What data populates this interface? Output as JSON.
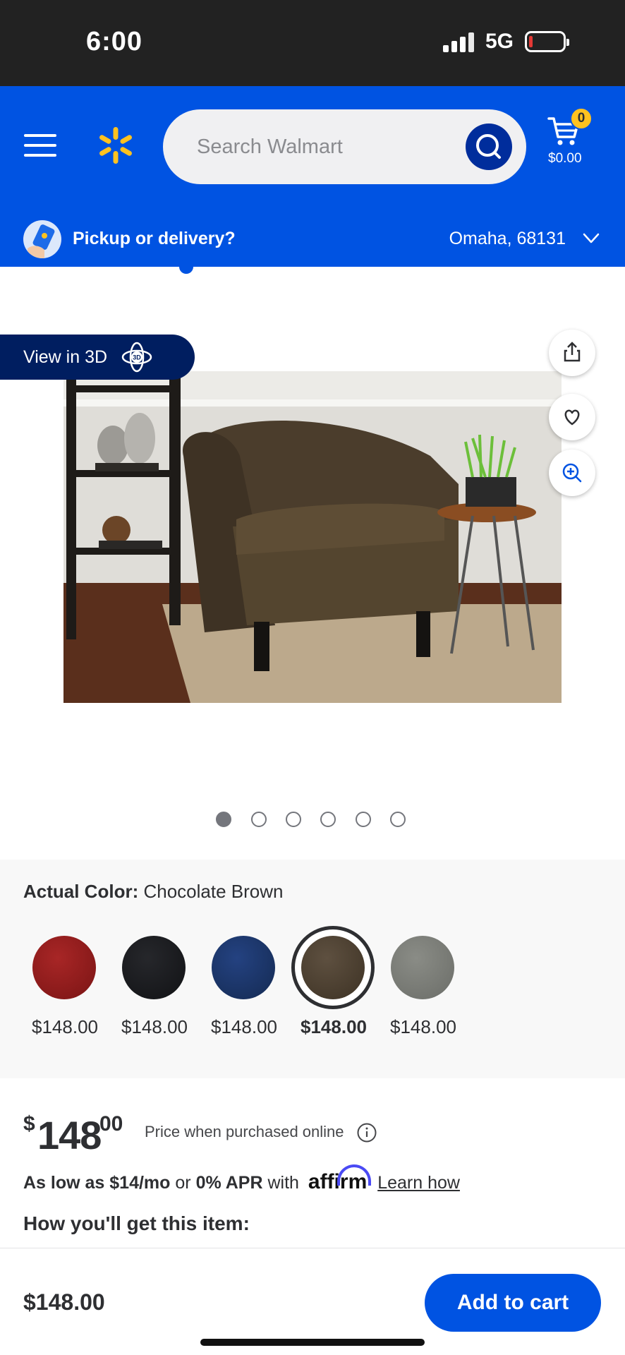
{
  "status_bar": {
    "time": "6:00",
    "network": "5G"
  },
  "header": {
    "search": {
      "placeholder": "Search Walmart"
    },
    "cart": {
      "count": "0",
      "total": "$0.00"
    },
    "pickup": {
      "label": "Pickup or delivery?",
      "location": "Omaha, 68131"
    }
  },
  "gallery": {
    "view3d_label": "View in 3D",
    "dots_total": 6,
    "active_dot": 1
  },
  "variants": {
    "label": "Actual Color:",
    "selected_color": "Chocolate Brown",
    "swatches": [
      {
        "color": "#8f1c1c",
        "price": "$148.00",
        "selected": false
      },
      {
        "color": "#18191c",
        "price": "$148.00",
        "selected": false
      },
      {
        "color": "#1d3564",
        "price": "$148.00",
        "selected": false
      },
      {
        "color": "#4e4232",
        "price": "$148.00",
        "selected": true
      },
      {
        "color": "#7b7d77",
        "price": "$148.00",
        "selected": false
      }
    ]
  },
  "price": {
    "currency": "$",
    "dollars": "148",
    "cents": "00",
    "note": "Price when purchased online",
    "affirm": {
      "as_low_as": "As low as $14/mo",
      "or": "or",
      "apr": "0% APR",
      "with": "with",
      "logo": "affirm",
      "learn": "Learn how"
    },
    "fulfillment_heading": "How you'll get this item:"
  },
  "bottom_bar": {
    "price": "$148.00",
    "button": "Add to cart"
  },
  "colors": {
    "brand_blue": "#0053e2",
    "spark_yellow": "#ffc220",
    "dark_navy": "#001e60"
  }
}
